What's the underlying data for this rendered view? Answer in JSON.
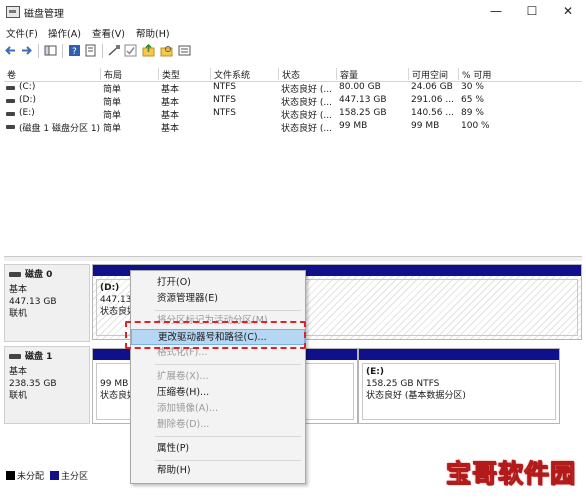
{
  "window": {
    "title": "磁盘管理",
    "minimize": "—",
    "maximize": "☐",
    "close": "✕"
  },
  "menu": [
    "文件(F)",
    "操作(A)",
    "查看(V)",
    "帮助(H)"
  ],
  "table": {
    "columns": [
      "卷",
      "布局",
      "类型",
      "文件系统",
      "状态",
      "容量",
      "可用空间",
      "% 可用"
    ],
    "rows": [
      [
        "(C:)",
        "简单",
        "基本",
        "NTFS",
        "状态良好 (...",
        "80.00 GB",
        "24.06 GB",
        "30 %"
      ],
      [
        "(D:)",
        "简单",
        "基本",
        "NTFS",
        "状态良好 (...",
        "447.13 GB",
        "291.06 ...",
        "65 %"
      ],
      [
        "(E:)",
        "简单",
        "基本",
        "NTFS",
        "状态良好 (...",
        "158.25 GB",
        "140.56 ...",
        "89 %"
      ],
      [
        "(磁盘 1 磁盘分区 1)",
        "简单",
        "基本",
        "",
        "状态良好 (...",
        "99 MB",
        "99 MB",
        "100 %"
      ]
    ]
  },
  "disks": [
    {
      "name": "磁盘 0",
      "type": "基本",
      "size": "447.13 GB",
      "state": "联机",
      "partition": {
        "label": "(D:)",
        "line1": "447.13",
        "line2": "状态良好"
      }
    },
    {
      "name": "磁盘 1",
      "type": "基本",
      "size": "238.35 GB",
      "state": "联机",
      "partitions": [
        {
          "label": "",
          "line1": "99 MB",
          "line2": "状态良好"
        },
        {
          "label": "(E:)",
          "line1": "158.25 GB NTFS",
          "line2": "状态良好 (基本数据分区)"
        }
      ]
    }
  ],
  "legend": {
    "unallocated": "未分配",
    "primary": "主分区",
    "unallocated_color": "#000000",
    "primary_color": "#10108a"
  },
  "context_menu": {
    "items": [
      {
        "label": "打开(O)",
        "disabled": false
      },
      {
        "label": "资源管理器(E)",
        "disabled": false
      },
      {
        "label": "将分区标记为活动分区(M)",
        "disabled": true
      },
      {
        "label": "更改驱动器号和路径(C)...",
        "disabled": false,
        "highlighted": true
      },
      {
        "label": "格式化(F)...",
        "disabled": true
      },
      {
        "label": "扩展卷(X)...",
        "disabled": true
      },
      {
        "label": "压缩卷(H)...",
        "disabled": false
      },
      {
        "label": "添加镜像(A)...",
        "disabled": true
      },
      {
        "label": "删除卷(D)...",
        "disabled": true
      },
      {
        "label": "属性(P)",
        "disabled": false
      },
      {
        "label": "帮助(H)",
        "disabled": false
      }
    ]
  },
  "watermark": "宝哥软件园",
  "colors": {
    "highlight": "#b5d7f3",
    "callout": "#e0202c",
    "partition_band": "#10108a"
  }
}
